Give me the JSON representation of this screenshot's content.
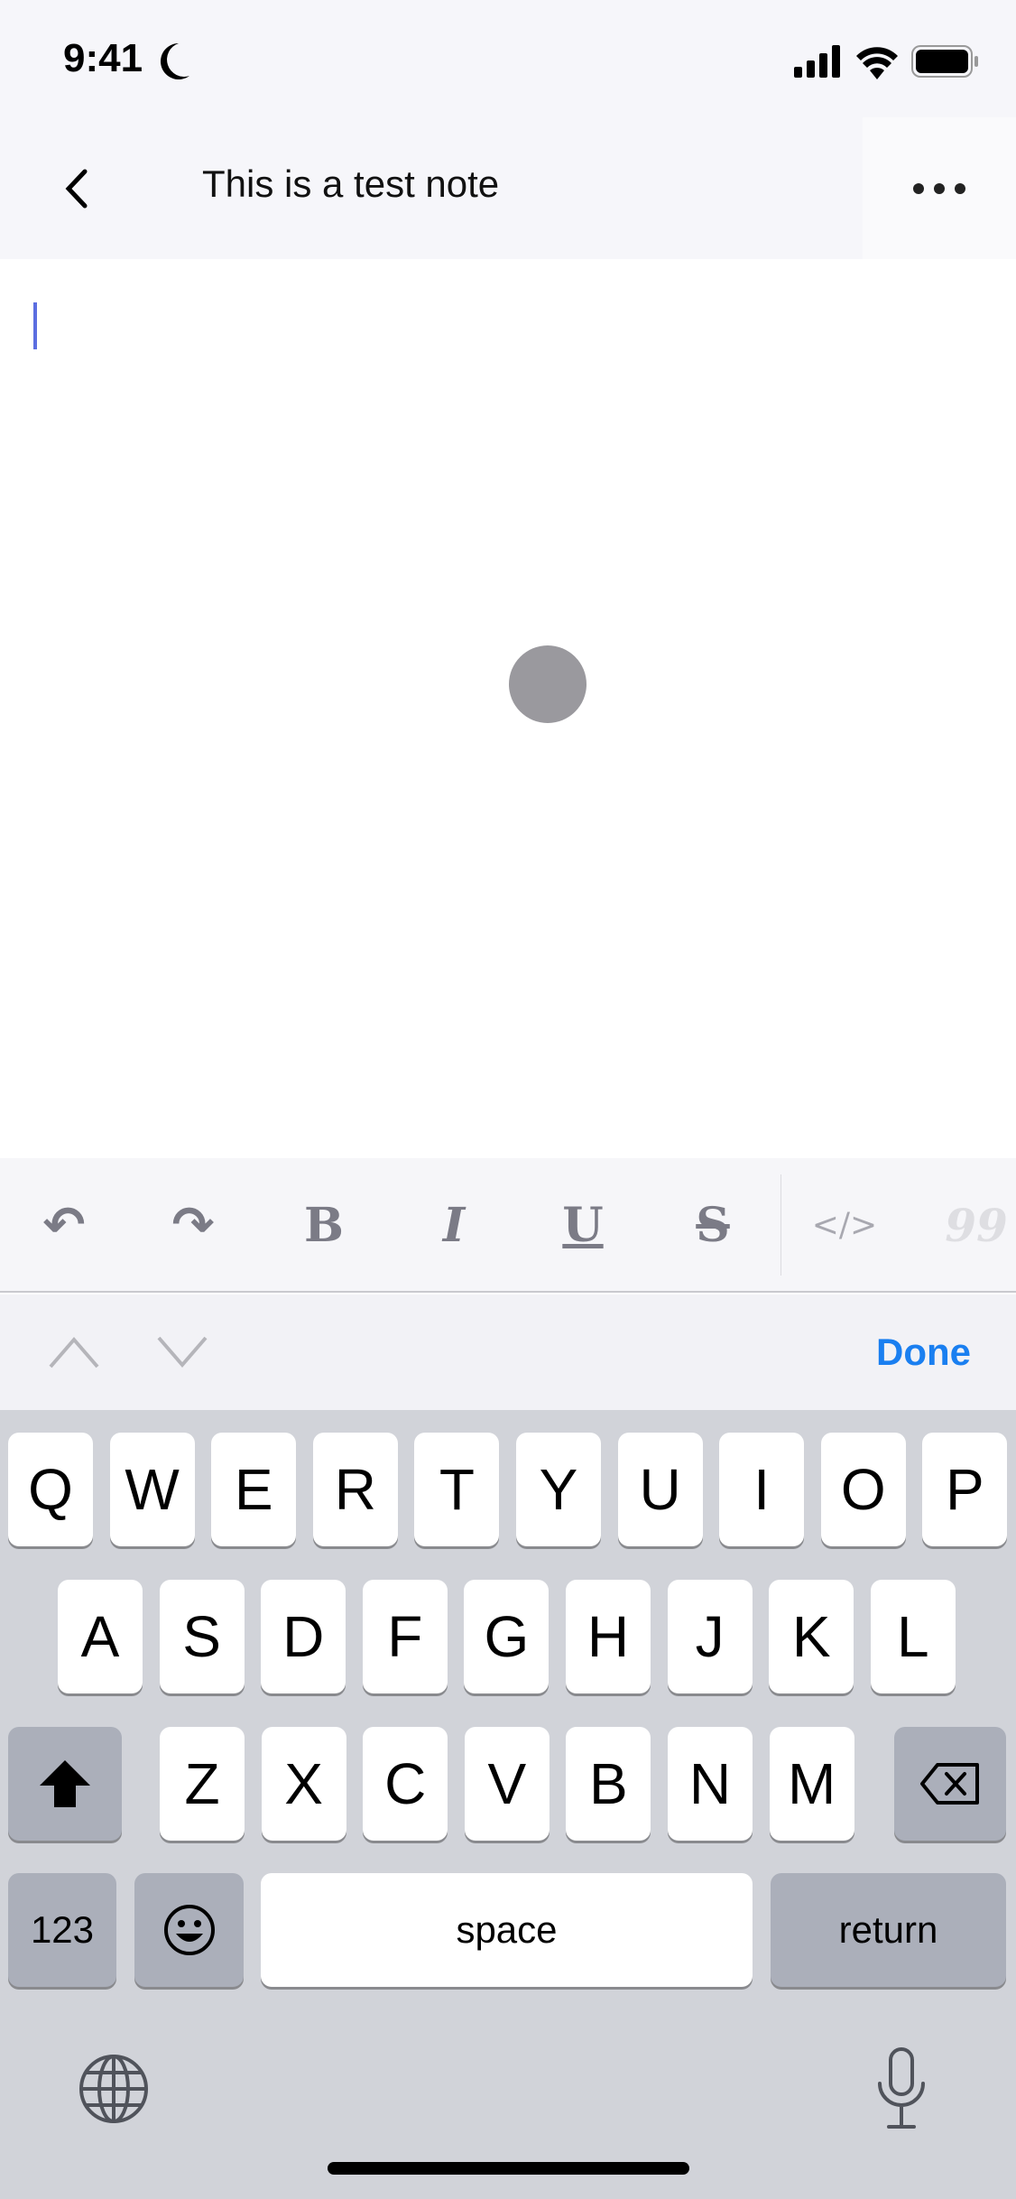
{
  "status_bar": {
    "time": "9:41",
    "icons": [
      "moon-icon",
      "signal-icon",
      "wifi-icon",
      "battery-icon"
    ]
  },
  "nav": {
    "title": "This is a test note",
    "back_icon": "chevron-left-icon",
    "more_icon": "ellipsis-icon"
  },
  "toolbar": {
    "items": [
      {
        "name": "undo",
        "glyph": "↶"
      },
      {
        "name": "redo",
        "glyph": "↷"
      },
      {
        "name": "bold",
        "glyph": "B"
      },
      {
        "name": "italic",
        "glyph": "I"
      },
      {
        "name": "underline",
        "glyph": "U"
      },
      {
        "name": "strikethrough",
        "glyph": "S"
      },
      {
        "name": "code",
        "glyph": "</>"
      },
      {
        "name": "quote",
        "glyph": "99"
      }
    ]
  },
  "accessory": {
    "done_label": "Done"
  },
  "keyboard": {
    "row1": [
      "Q",
      "W",
      "E",
      "R",
      "T",
      "Y",
      "U",
      "I",
      "O",
      "P"
    ],
    "row2": [
      "A",
      "S",
      "D",
      "F",
      "G",
      "H",
      "J",
      "K",
      "L"
    ],
    "row3": [
      "Z",
      "X",
      "C",
      "V",
      "B",
      "N",
      "M"
    ],
    "numbers_label": "123",
    "space_label": "space",
    "return_label": "return"
  },
  "colors": {
    "accent": "#1a7ff0",
    "cursor": "#5b6ee1",
    "keyboard_bg": "#d1d3d9"
  }
}
